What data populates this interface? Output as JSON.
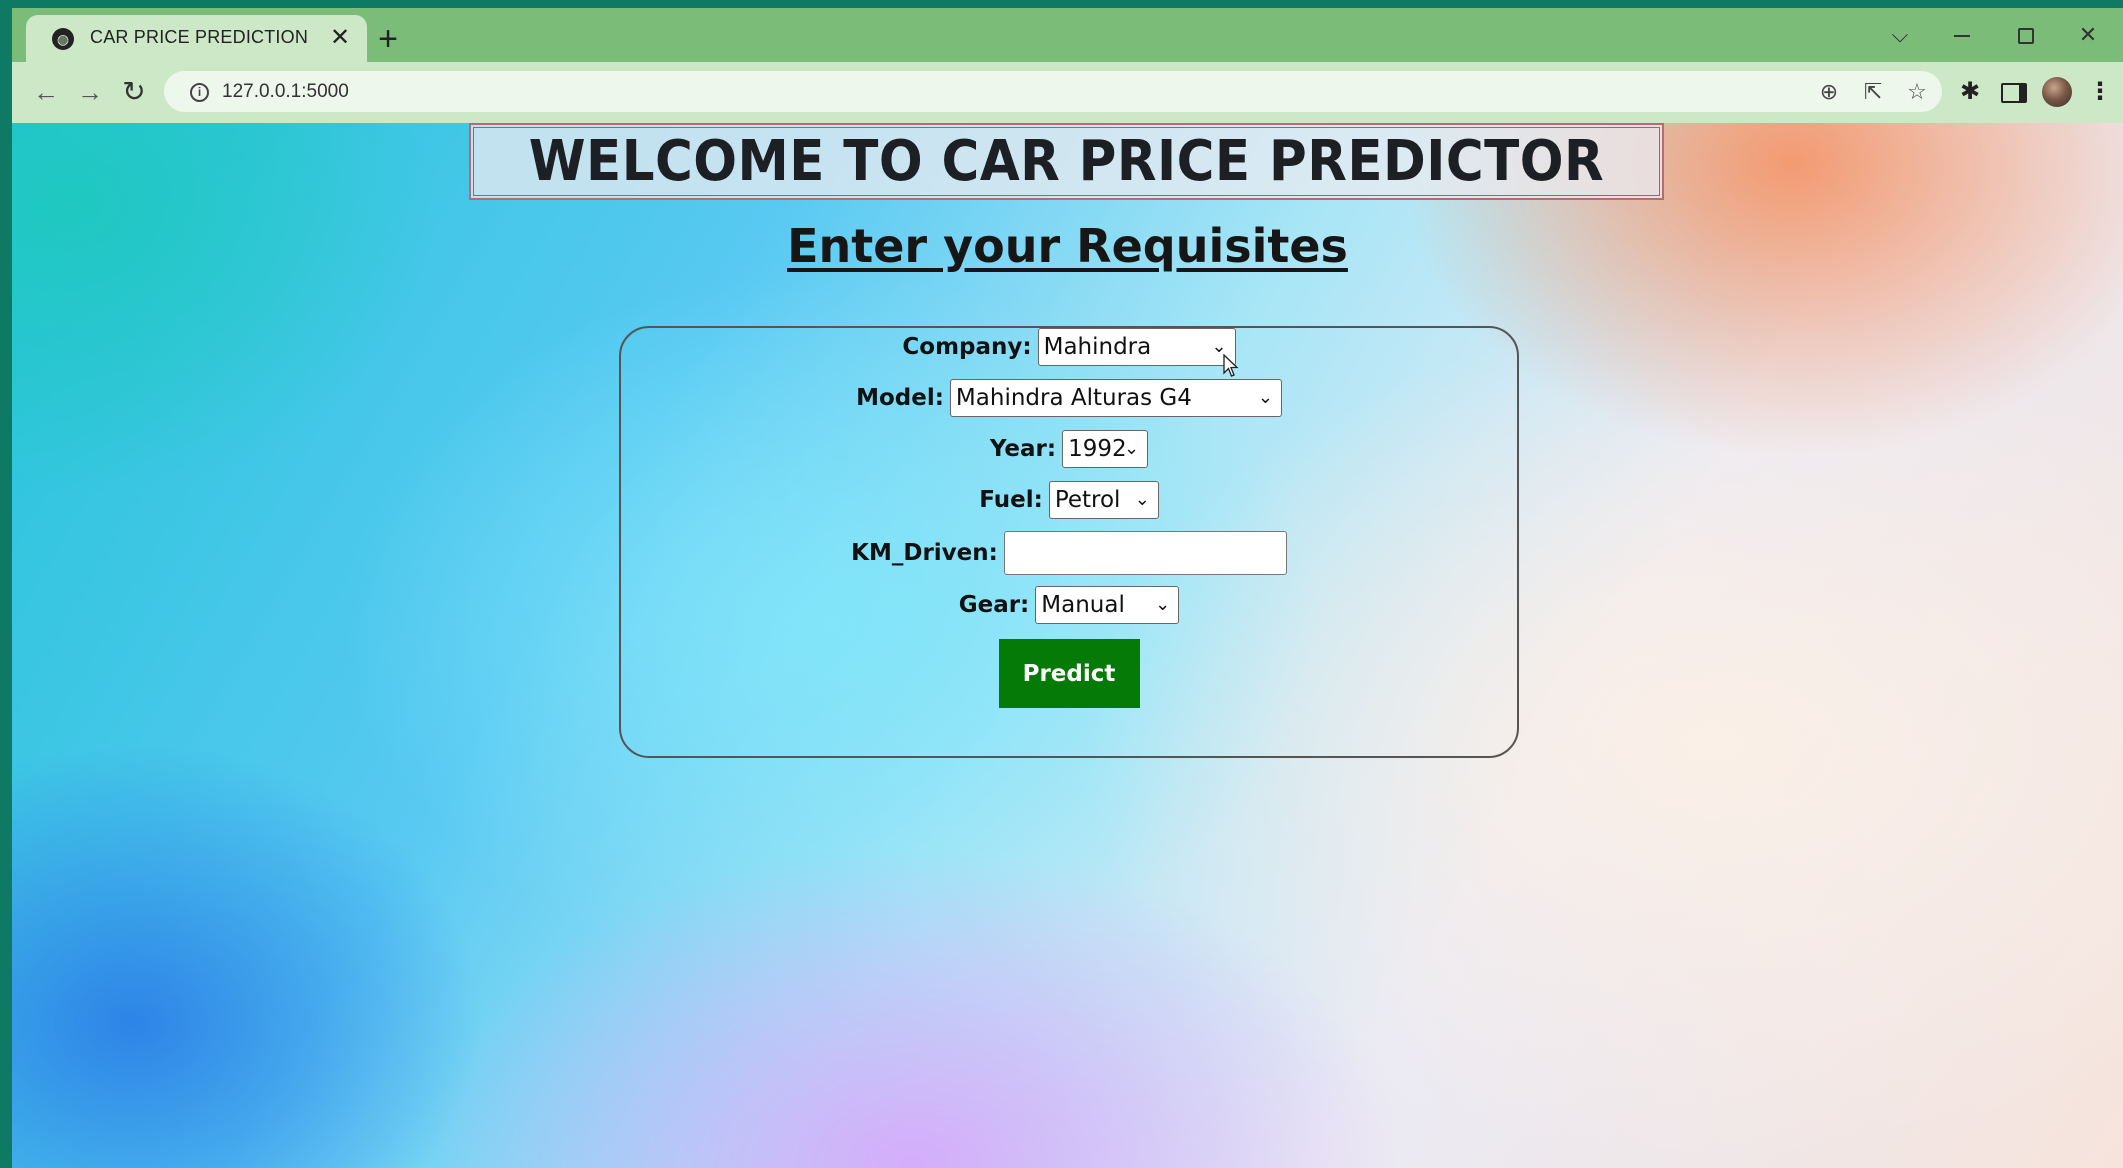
{
  "browser": {
    "tab_title": "CAR PRICE PREDICTION",
    "tab_close": "✕",
    "new_tab": "+",
    "url": "127.0.0.1:5000",
    "window_controls": {
      "tab_search": "⌵",
      "close": "✕"
    },
    "menu_glyph": "⋮",
    "icons": [
      "globe-icon",
      "info-icon",
      "zoom-icon",
      "share-icon",
      "star-icon",
      "puzzle-icon",
      "side-panel-icon",
      "profile-avatar",
      "kebab-menu-icon"
    ]
  },
  "page": {
    "banner_title": "WELCOME TO CAR PRICE PREDICTOR",
    "subtitle": "Enter your Requisites",
    "form": {
      "company": {
        "label": "Company:",
        "value": "Mahindra"
      },
      "model": {
        "label": "Model:",
        "value": "Mahindra Alturas G4"
      },
      "year": {
        "label": "Year:",
        "value": "1992"
      },
      "fuel": {
        "label": "Fuel:",
        "value": "Petrol"
      },
      "km_driven": {
        "label": "KM_Driven:",
        "value": ""
      },
      "gear": {
        "label": "Gear:",
        "value": "Manual"
      },
      "submit_label": "Predict"
    },
    "colors": {
      "predict_button": "#067a06",
      "browser_frame": "#7bbd78",
      "toolbar": "#cde8c7"
    }
  }
}
